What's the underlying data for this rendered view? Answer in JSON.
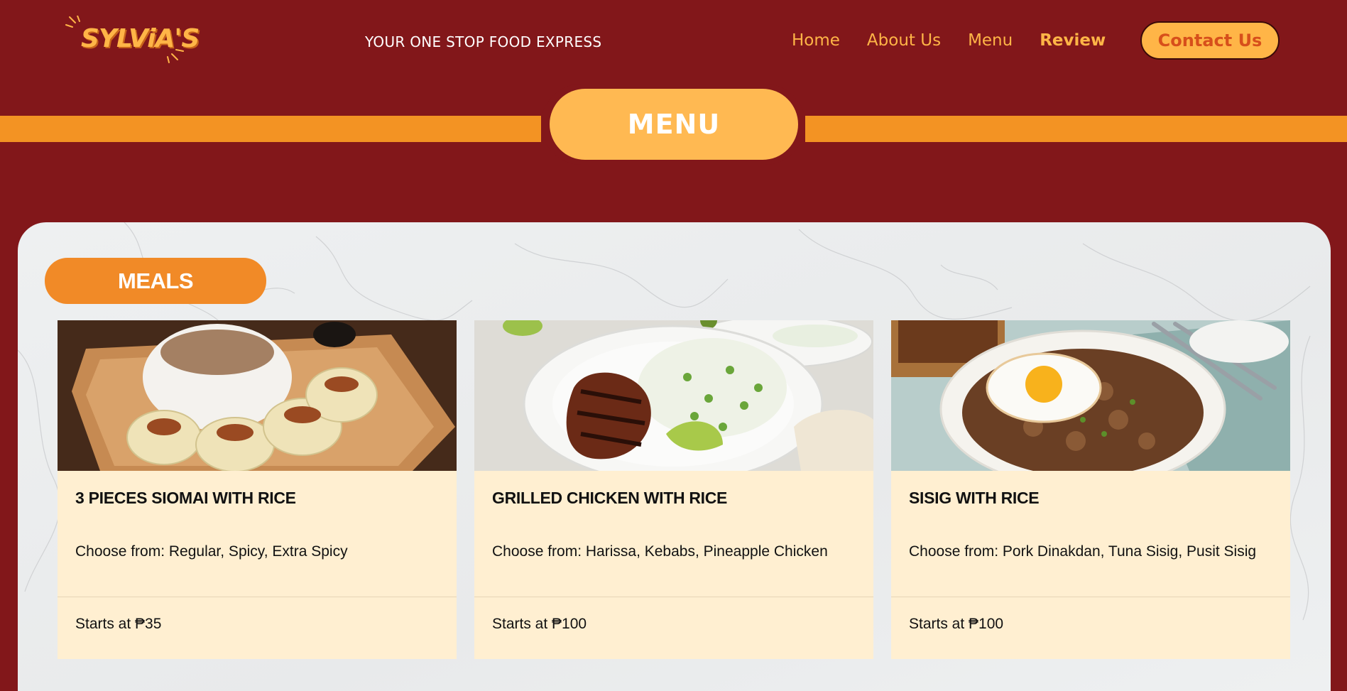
{
  "header": {
    "logo_text": "SYLViA'S",
    "tagline": "YOUR ONE STOP FOOD EXPRESS",
    "nav": [
      {
        "label": "Home"
      },
      {
        "label": "About Us"
      },
      {
        "label": "Menu"
      },
      {
        "label": "Review"
      }
    ],
    "contact_label": "Contact Us"
  },
  "banner": {
    "title": "MENU"
  },
  "section": {
    "tab_label": "MEALS"
  },
  "cards": [
    {
      "title": "3 PIECES SIOMAI WITH RICE",
      "description": "Choose from: Regular, Spicy, Extra Spicy",
      "price": "Starts at ₱35"
    },
    {
      "title": "GRILLED CHICKEN WITH RICE",
      "description": "Choose from: Harissa, Kebabs, Pineapple Chicken",
      "price": "Starts at ₱100"
    },
    {
      "title": "SISIG WITH RICE",
      "description": "Choose from: Pork Dinakdan, Tuna Sisig, Pusit Sisig",
      "price": "Starts at ₱100"
    }
  ],
  "colors": {
    "background": "#82171a",
    "accent": "#ffb547",
    "stripe": "#f39323",
    "card": "#ffefd1"
  }
}
